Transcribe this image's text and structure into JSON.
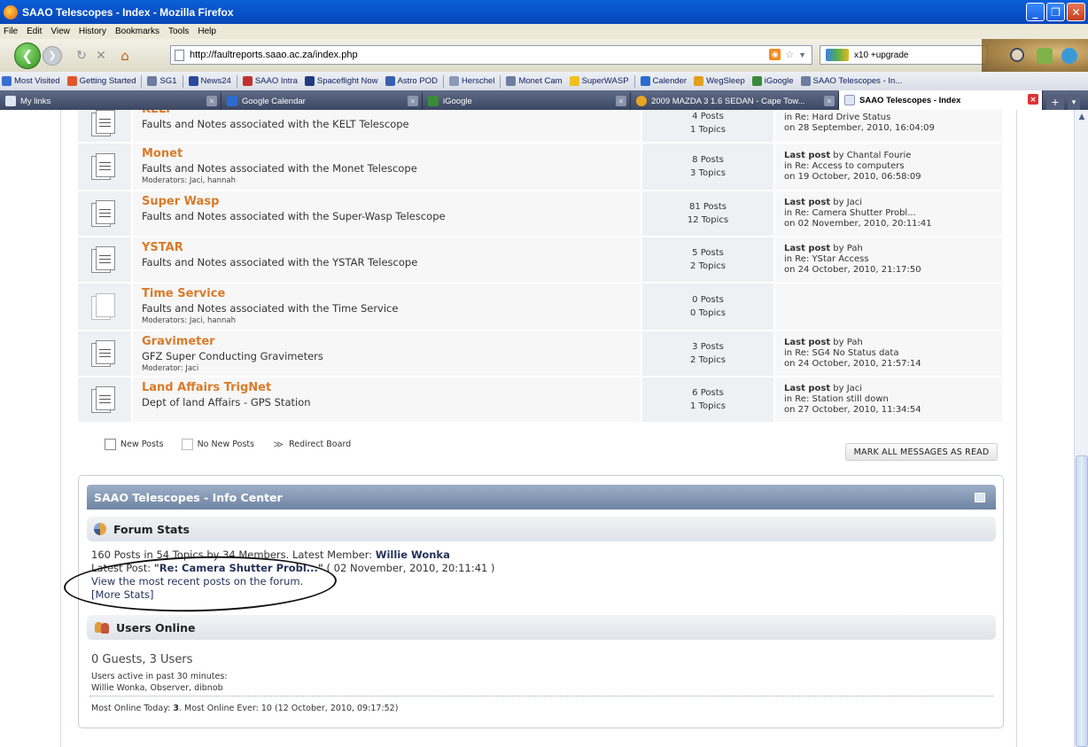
{
  "window": {
    "title": "SAAO Telescopes - Index - Mozilla Firefox"
  },
  "menu": [
    "File",
    "Edit",
    "View",
    "History",
    "Bookmarks",
    "Tools",
    "Help"
  ],
  "address_bar": {
    "url": "http://faultreports.saao.ac.za/index.php"
  },
  "search_bar": {
    "value": "x10 +upgrade"
  },
  "bookmarks": [
    {
      "label": "Most Visited",
      "color": "#3a6fd0"
    },
    {
      "label": "Getting Started",
      "color": "#e0552b"
    },
    {
      "label": "SG1",
      "color": "#6d7da0"
    },
    {
      "label": "News24",
      "color": "#2a4aa0"
    },
    {
      "label": "SAAO Intra",
      "color": "#c43030"
    },
    {
      "label": "Spaceflight Now",
      "color": "#223a80"
    },
    {
      "label": "Astro POD",
      "color": "#3b5fb0"
    },
    {
      "label": "Herschel",
      "color": "#8a9ab8"
    },
    {
      "label": "Monet Cam",
      "color": "#6d7da0"
    },
    {
      "label": "SuperWASP",
      "color": "#f0c020"
    },
    {
      "label": "Calender",
      "color": "#2a6bd0"
    },
    {
      "label": "WegSleep",
      "color": "#e0a020"
    },
    {
      "label": "iGoogle",
      "color": "#3a8a3a"
    },
    {
      "label": "SAAO Telescopes - In...",
      "color": "#6d7da0"
    }
  ],
  "tabs": [
    {
      "label": "My links",
      "active": false
    },
    {
      "label": "Google Calendar",
      "active": false
    },
    {
      "label": "iGoogle",
      "active": false
    },
    {
      "label": "2009 MAZDA 3 1.6 SEDAN - Cape Tow...",
      "active": false
    },
    {
      "label": "SAAO Telescopes - Index",
      "active": true
    }
  ],
  "boards": [
    {
      "name": "KELT",
      "description": "Faults and Notes associated with the KELT Telescope",
      "moderators": "",
      "posts": "4 Posts",
      "topics": "1 Topics",
      "last_post_label": "",
      "last_post_by": "",
      "last_post_subject": "in Re: Hard Drive Status",
      "last_post_date": "on 28 September, 2010, 16:04:09",
      "new": true
    },
    {
      "name": "Monet",
      "description": "Faults and Notes associated with the Monet Telescope",
      "moderators": "Moderators: Jaci, hannah",
      "posts": "8 Posts",
      "topics": "3 Topics",
      "last_post_label": "Last post",
      "last_post_by": " by Chantal Fourie",
      "last_post_subject": "in Re: Access to computers",
      "last_post_date": "on 19 October, 2010, 06:58:09",
      "new": true
    },
    {
      "name": "Super Wasp",
      "description": "Faults and Notes associated with the Super-Wasp Telescope",
      "moderators": "",
      "posts": "81 Posts",
      "topics": "12 Topics",
      "last_post_label": "Last post",
      "last_post_by": " by Jaci",
      "last_post_subject": "in Re: Camera Shutter Probl...",
      "last_post_date": "on 02 November, 2010, 20:11:41",
      "new": true
    },
    {
      "name": "YSTAR",
      "description": "Faults and Notes associated with the YSTAR Telescope",
      "moderators": "",
      "posts": "5 Posts",
      "topics": "2 Topics",
      "last_post_label": "Last post",
      "last_post_by": " by Pah",
      "last_post_subject": "in Re: YStar Access",
      "last_post_date": "on 24 October, 2010, 21:17:50",
      "new": true
    },
    {
      "name": "Time Service",
      "description": "Faults and Notes associated with the Time Service",
      "moderators": "Moderators: Jaci, hannah",
      "posts": "0 Posts",
      "topics": "0 Topics",
      "last_post_label": "",
      "last_post_by": "",
      "last_post_subject": "",
      "last_post_date": "",
      "new": false
    },
    {
      "name": "Gravimeter",
      "description": "GFZ Super Conducting Gravimeters",
      "moderators": "Moderator: Jaci",
      "posts": "3 Posts",
      "topics": "2 Topics",
      "last_post_label": "Last post",
      "last_post_by": " by Pah",
      "last_post_subject": "in Re: SG4 No Status data",
      "last_post_date": "on 24 October, 2010, 21:57:14",
      "new": true
    },
    {
      "name": "Land Affairs TrigNet",
      "description": "Dept of land Affairs - GPS Station",
      "moderators": "",
      "posts": "6 Posts",
      "topics": "1 Topics",
      "last_post_label": "Last post",
      "last_post_by": " by Jaci",
      "last_post_subject": "in Re: Station still down",
      "last_post_date": "on 27 October, 2010, 11:34:54",
      "new": true
    }
  ],
  "legend": {
    "new_posts": "New Posts",
    "no_new_posts": "No New Posts",
    "redirect_board": "Redirect Board"
  },
  "mark_all_read": "MARK ALL MESSAGES AS READ",
  "info_center": {
    "title": "SAAO Telescopes - Info Center",
    "forum_stats": {
      "heading": "Forum Stats",
      "summary_prefix": "160 Posts in 54 Topics by 34 Members. Latest Member: ",
      "latest_member": "Willie Wonka",
      "latest_post_prefix": "Latest Post: ",
      "latest_post_title": "\"Re: Camera Shutter Probl...\"",
      "latest_post_date": " ( 02 November, 2010, 20:11:41 )",
      "recent_link": "View the most recent posts on the forum.",
      "more_stats": "[More Stats]"
    },
    "users_online": {
      "heading": "Users Online",
      "guests_users": "0 Guests, 3 Users",
      "active_label": "Users active in past 30 minutes:",
      "active_users": "Willie Wonka, Observer, dibnob",
      "most_online": "Most Online Today: ",
      "most_today": "3",
      "most_ever": ". Most Online Ever: 10 (12 October, 2010, 09:17:52)"
    }
  }
}
